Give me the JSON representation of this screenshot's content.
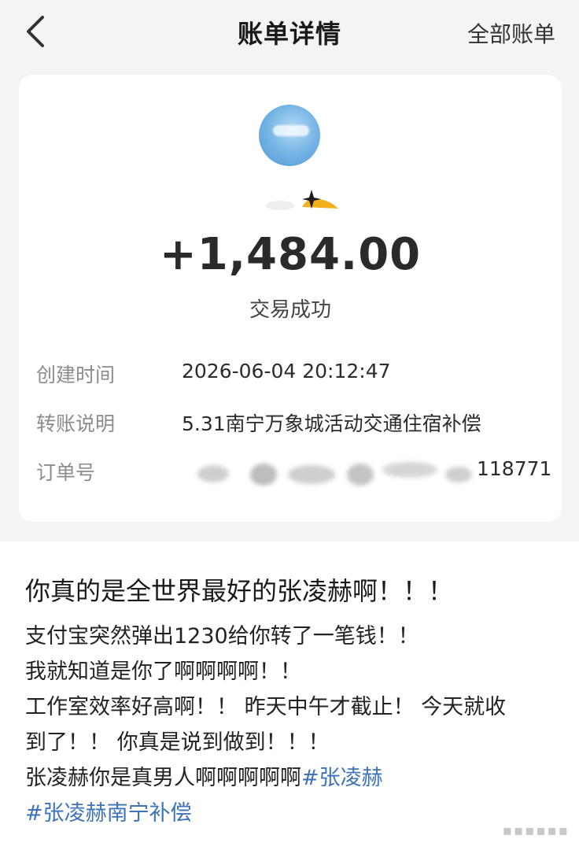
{
  "nav": {
    "title": "账单详情",
    "right_label": "全部账单"
  },
  "transaction": {
    "amount": "+1,484.00",
    "status": "交易成功",
    "details": [
      {
        "label": "创建时间",
        "value": "2026-06-04 20:12:47"
      },
      {
        "label": "转账说明",
        "value": "5.31南宁万象城活动交通住宿补偿"
      },
      {
        "label": "订单号",
        "value": "118771"
      }
    ]
  },
  "post": {
    "title": "你真的是全世界最好的张凌赫啊！！！",
    "lines": [
      "支付宝突然弹出1230给你转了一笔钱！！",
      "我就知道是你了啊啊啊啊！！",
      "工作室效率好高啊！！ 昨天中午才截止！ 今天就收",
      "到了！！ 你真是说到做到！！！"
    ],
    "last_line_text": "张凌赫你是真男人啊啊啊啊啊",
    "tags": [
      "#张凌赫",
      "#张凌赫南宁补偿"
    ]
  },
  "colors": {
    "background": "#f4f4f4",
    "card": "#ffffff",
    "tag": "#3e73b8",
    "label": "#8c8c8c"
  },
  "icons": [
    "back-arrow-icon",
    "user-avatar",
    "sparkle-icon"
  ]
}
